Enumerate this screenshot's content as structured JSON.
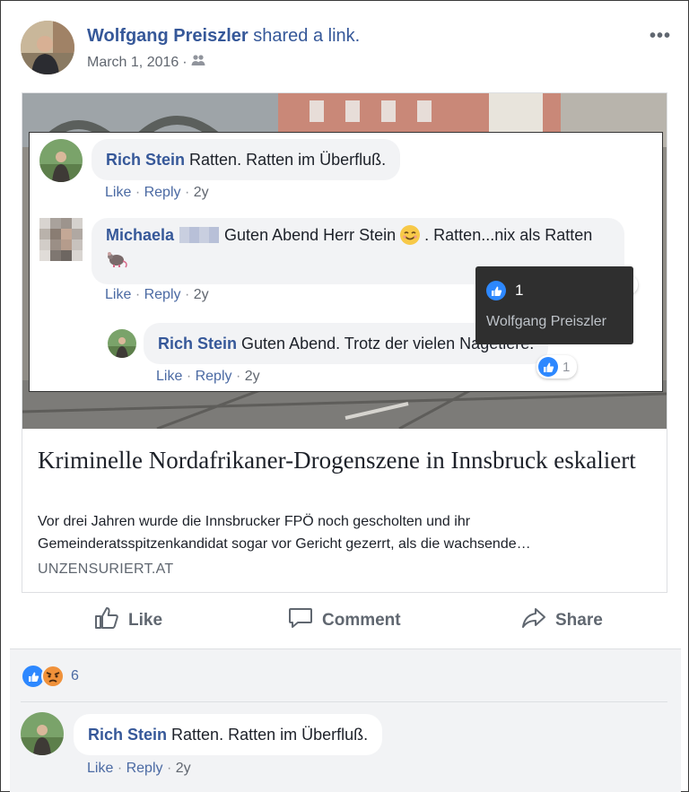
{
  "post": {
    "author": "Wolfgang Preiszler",
    "action_text": "shared a link.",
    "date": "March 1, 2016",
    "date_separator": "·",
    "privacy_icon": "friends-icon",
    "more_icon": "more-dots-icon",
    "more_label": "•••"
  },
  "screenshot": {
    "comments": [
      {
        "author": "Rich Stein",
        "text": "Ratten. Ratten im Überfluß.",
        "like": "Like",
        "reply": "Reply",
        "age": "2y"
      },
      {
        "author": "Michaela",
        "text_before_emoji": "Guten Abend Herr Stein",
        "emoji": "smiling-face-icon",
        "text_after_emoji": ". Ratten...nix als Ratten",
        "second_line_emoji": "rat-icon",
        "like": "Like",
        "reply": "Reply",
        "age": "2y",
        "reaction_count": "1"
      },
      {
        "author": "Rich Stein",
        "text": "Guten Abend. Trotz der vielen Nagetiere.",
        "like": "Like",
        "reply": "Reply",
        "age": "2y",
        "reaction_count": "1"
      }
    ],
    "tooltip": {
      "count": "1",
      "name": "Wolfgang Preiszler"
    }
  },
  "link": {
    "title": "Kriminelle Nordafrikaner-Drogenszene in Innsbruck eskaliert",
    "description": "Vor drei Jahren wurde die Innsbrucker FPÖ noch gescholten und ihr Gemeinderatsspitzenkandidat sogar vor Gericht gezerrt, als die wachsende…",
    "domain": "UNZENSURIERT.AT"
  },
  "actions": {
    "like": "Like",
    "comment": "Comment",
    "share": "Share"
  },
  "reactions": {
    "count": "6",
    "types": [
      "like-icon",
      "angry-icon"
    ]
  },
  "footer_comment": {
    "author": "Rich Stein",
    "text": "Ratten. Ratten im Überfluß.",
    "like": "Like",
    "reply": "Reply",
    "age": "2y"
  },
  "colors": {
    "link_blue": "#365899",
    "like_blue": "#2d88ff",
    "angry_orange": "#f0913a",
    "tooltip_bg": "#2f2f2f"
  }
}
